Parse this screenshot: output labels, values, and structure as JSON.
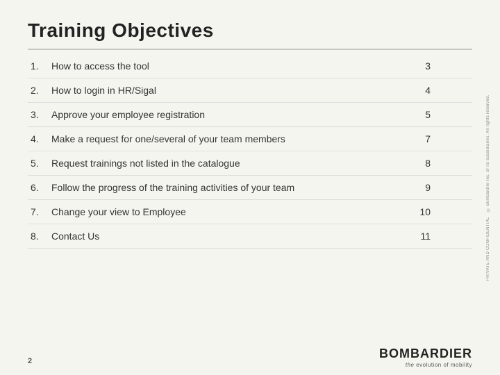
{
  "title": "Training Objectives",
  "divider": true,
  "toc": {
    "items": [
      {
        "num": "1.",
        "label": "How to access the tool",
        "page": "3"
      },
      {
        "num": "2.",
        "label": "How to login in HR/Sigal",
        "page": "4"
      },
      {
        "num": "3.",
        "label": "Approve your employee registration",
        "page": "5"
      },
      {
        "num": "4.",
        "label": "Make a request for one/several of your team members",
        "page": "7"
      },
      {
        "num": "5.",
        "label": "Request trainings not listed in the catalogue",
        "page": "8"
      },
      {
        "num": "6.",
        "label": "Follow the progress of the training activities of your team",
        "page": "9"
      },
      {
        "num": "7.",
        "label": "Change your view to Employee",
        "page": "10"
      },
      {
        "num": "8.",
        "label": "Contact Us",
        "page": "11"
      }
    ]
  },
  "sidebar": {
    "text": "PRIVATE AND CONFIDENTIAL © Bombardier Inc. or its subsidiaries. All rights reserved."
  },
  "footer": {
    "page_number": "2"
  },
  "logo": {
    "name": "BOMBARDIER",
    "tagline_the": "the",
    "tagline_rest": "evolution of mobility"
  }
}
